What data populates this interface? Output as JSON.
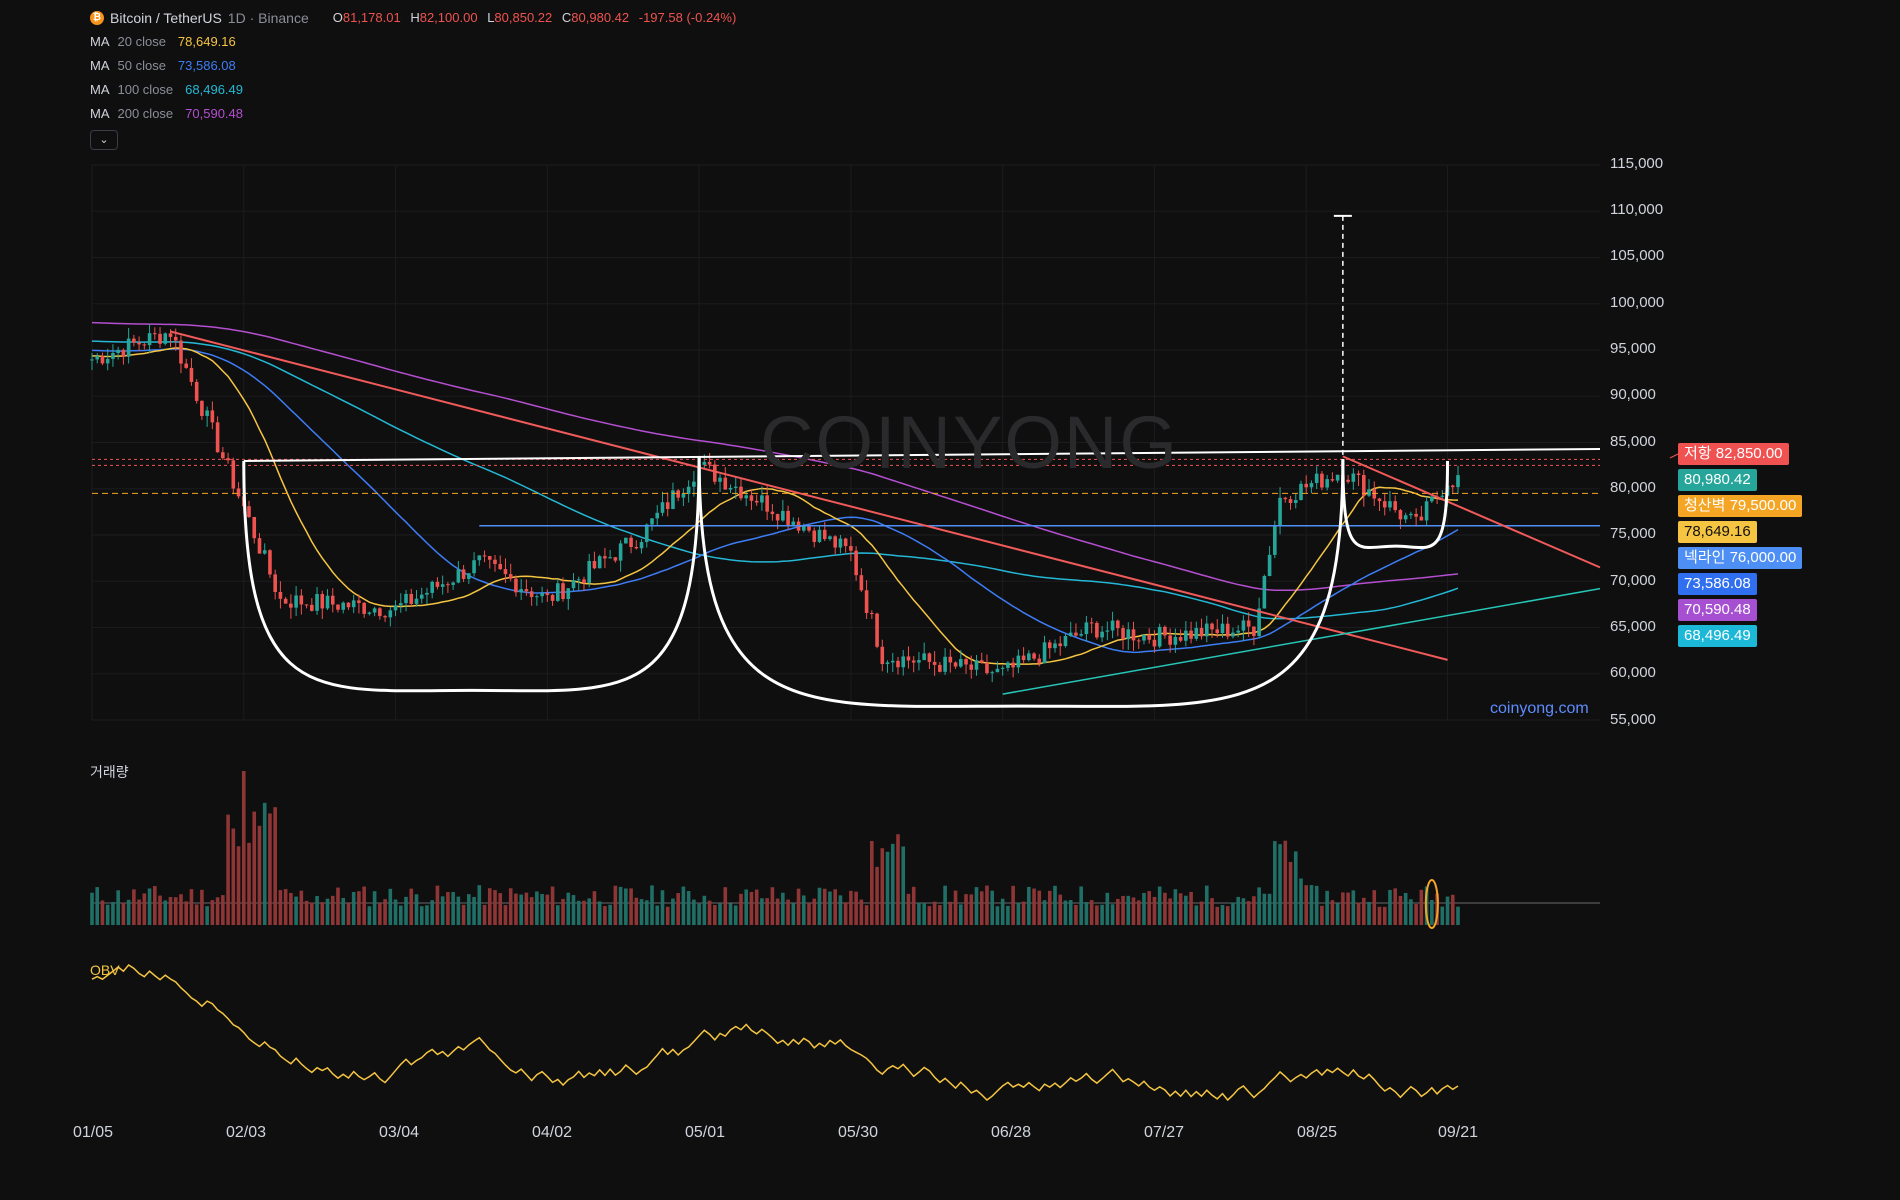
{
  "header": {
    "symbol": "Bitcoin / TetherUS",
    "interval_exchange": "1D · Binance",
    "open_label": "O",
    "open": "81,178.01",
    "high_label": "H",
    "high": "82,100.00",
    "low_label": "L",
    "low": "80,850.22",
    "close_label": "C",
    "close": "80,980.42",
    "change": "-197.58 (-0.24%)"
  },
  "ma_legend": [
    {
      "name": "MA",
      "param": "20 close",
      "value": "78,649.16",
      "color": "#f5c542"
    },
    {
      "name": "MA",
      "param": "50 close",
      "value": "73,586.08",
      "color": "#3d7df5"
    },
    {
      "name": "MA",
      "param": "100 close",
      "value": "68,496.49",
      "color": "#24b8d6"
    },
    {
      "name": "MA",
      "param": "200 close",
      "value": "70,590.48",
      "color": "#b44fd0"
    }
  ],
  "watermark": "COINYONG",
  "site": "coinyong.com",
  "volume_label": "거래량",
  "obv_label": "OBV",
  "price_axis": [
    "115,000",
    "110,000",
    "105,000",
    "100,000",
    "95,000",
    "90,000",
    "85,000",
    "80,000",
    "75,000",
    "70,000",
    "65,000",
    "60,000",
    "55,000"
  ],
  "date_axis": [
    "01/05",
    "02/03",
    "03/04",
    "04/02",
    "05/01",
    "05/30",
    "06/28",
    "07/27",
    "08/25",
    "09/21"
  ],
  "price_labels": [
    {
      "text": "저항 82,850.00",
      "color": "#f05252"
    },
    {
      "text": "80,980.42",
      "color": "#26a69a"
    },
    {
      "text": "청산벽 79,500.00",
      "color": "#f5a524"
    },
    {
      "text": "78,649.16",
      "color": "#f5c542"
    },
    {
      "text": "넥라인 76,000.00",
      "color": "#4d8ff5"
    },
    {
      "text": "73,586.08",
      "color": "#2f6ff0"
    },
    {
      "text": "70,590.48",
      "color": "#a64fd0"
    },
    {
      "text": "68,496.49",
      "color": "#1cb8d8"
    }
  ],
  "colors": {
    "up": "#26a69a",
    "down": "#ef5350",
    "obv": "#f5c542",
    "trend": "#f05a5a",
    "support": "#26c6b8"
  },
  "chart_data": {
    "type": "candlestick",
    "title": "Bitcoin / TetherUS 1D · Binance",
    "x_range": [
      "01/05",
      "09/21"
    ],
    "ylim": [
      55000,
      115000
    ],
    "price_path": [
      {
        "date": "01/05",
        "close": 94000
      },
      {
        "date": "01/20",
        "close": 97000
      },
      {
        "date": "02/03",
        "close": 78000
      },
      {
        "date": "02/10",
        "close": 68000
      },
      {
        "date": "03/04",
        "close": 67000
      },
      {
        "date": "03/20",
        "close": 72000
      },
      {
        "date": "04/02",
        "close": 68000
      },
      {
        "date": "04/20",
        "close": 75000
      },
      {
        "date": "05/01",
        "close": 82500
      },
      {
        "date": "05/15",
        "close": 78000
      },
      {
        "date": "05/30",
        "close": 73000
      },
      {
        "date": "06/05",
        "close": 62000
      },
      {
        "date": "06/28",
        "close": 60000
      },
      {
        "date": "07/15",
        "close": 65000
      },
      {
        "date": "07/27",
        "close": 64000
      },
      {
        "date": "08/15",
        "close": 65000
      },
      {
        "date": "08/20",
        "close": 79000
      },
      {
        "date": "09/01",
        "close": 82000
      },
      {
        "date": "09/15",
        "close": 76000
      },
      {
        "date": "09/21",
        "close": 80980
      }
    ],
    "levels": [
      {
        "name": "저항",
        "value": 82850
      },
      {
        "name": "청산벽",
        "value": 79500
      },
      {
        "name": "넥라인",
        "value": 76000
      }
    ],
    "moving_averages": [
      {
        "name": "MA 20",
        "last": 78649.16
      },
      {
        "name": "MA 50",
        "last": 73586.08
      },
      {
        "name": "MA 100",
        "last": 68496.49
      },
      {
        "name": "MA 200",
        "last": 70590.48
      }
    ],
    "target_projection": 109500
  }
}
